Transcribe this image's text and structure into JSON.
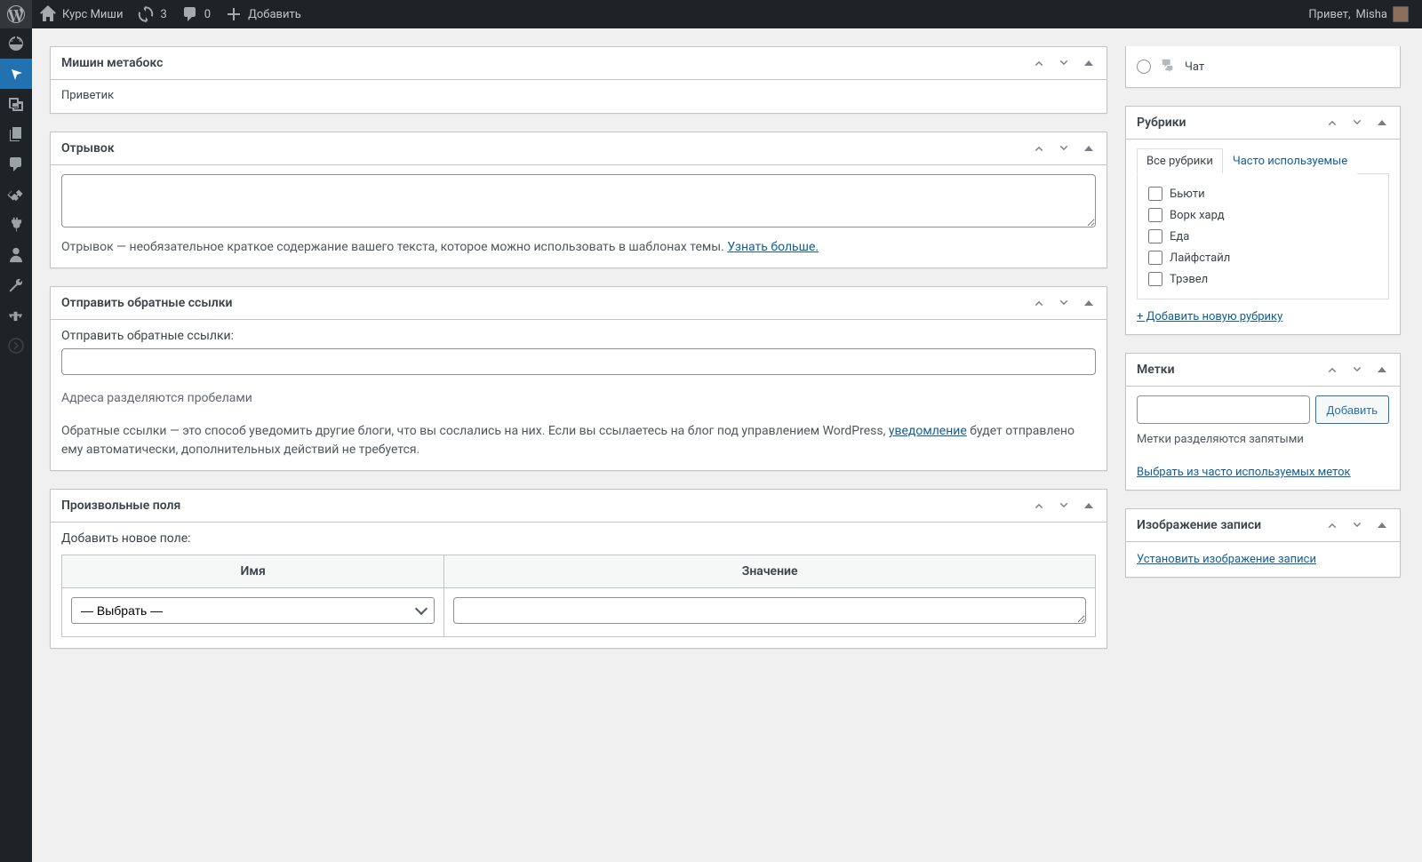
{
  "adminbar": {
    "site_title": "Курс Миши",
    "updates_count": "3",
    "comments_count": "0",
    "new_label": "Добавить",
    "howdy_prefix": "Привет,",
    "user": "Misha"
  },
  "metabox_custom": {
    "title": "Мишин метабокс",
    "content": "Приветик"
  },
  "metabox_excerpt": {
    "title": "Отрывок",
    "value": "",
    "help_before_link": "Отрывок — необязательное краткое содержание вашего текста, которое можно использовать в шаблонах темы. ",
    "help_link": "Узнать больше."
  },
  "metabox_trackbacks": {
    "title": "Отправить обратные ссылки",
    "field_label": "Отправить обратные ссылки:",
    "value": "",
    "hint": "Адреса разделяются пробелами",
    "desc_before": "Обратные ссылки — это способ уведомить другие блоги, что вы сослались на них. Если вы ссылаетесь на блог под управлением WordPress, ",
    "desc_link": "уведомление",
    "desc_after": " будет отправлено ему автоматически, дополнительных действий не требуется."
  },
  "metabox_customfields": {
    "title": "Произвольные поля",
    "add_label": "Добавить новое поле:",
    "col_name": "Имя",
    "col_value": "Значение",
    "select_placeholder": "— Выбрать —"
  },
  "side_format": {
    "chat_label": "Чат"
  },
  "side_categories": {
    "title": "Рубрики",
    "tab_all": "Все рубрики",
    "tab_most": "Часто используемые",
    "items": [
      "Бьюти",
      "Ворк хард",
      "Еда",
      "Лайфстайл",
      "Трэвел"
    ],
    "add_new": "+ Добавить новую рубрику"
  },
  "side_tags": {
    "title": "Метки",
    "add_btn": "Добавить",
    "hint": "Метки разделяются запятыми",
    "choose_link": "Выбрать из часто используемых меток"
  },
  "side_featured": {
    "title": "Изображение записи",
    "set_link": "Установить изображение записи"
  }
}
